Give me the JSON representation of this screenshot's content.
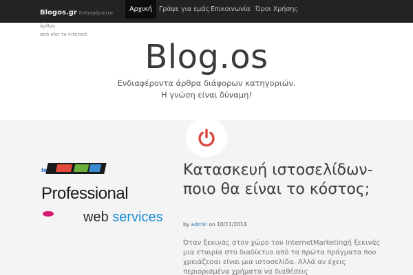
{
  "navbar": {
    "brand_name": "Blogos.gr",
    "brand_tag_1": "Ενδιαφέροντα άρθρα",
    "brand_tag_2": "από όλο το internet",
    "items": [
      {
        "label": "Αρχική",
        "active": true
      },
      {
        "label": "Γράψε για εμάς",
        "active": false
      },
      {
        "label": "Επικοινωνία",
        "active": false
      },
      {
        "label": "Όροι Χρήσης",
        "active": false
      }
    ]
  },
  "header": {
    "title": "Blog.os",
    "description_line_1": "Ενδιαφέροντα άρθρα διάφορων κατηγοριών.",
    "description_line_2": "Η γνώση είναι δύναμη!"
  },
  "icons": {
    "section_badge": "power-icon"
  },
  "colors": {
    "accent": "#d9463c",
    "navbar": "#232323",
    "content_bg": "#f4f4f4"
  },
  "post": {
    "image": {
      "corner_text": "le",
      "headline": "Professional",
      "line2_a": "web",
      "line2_b": "services"
    },
    "title": "Κατασκευή ιστοσελίδων- ποιο θα είναι το κόστος;",
    "meta_by": "by",
    "author": "admin",
    "meta_on": "on",
    "date": "10/11/2014",
    "excerpt": "Όταν ξεκινάς στον χώρο του InternetMarketingή ξεκινάς μια εταιρία στο διαδίκτυο από τα πρώτα πράγματα που χρειάζεσαι είναι μια ιστοσελίδα. Αλλά αν έχεις περιορισμένα χρήματα να διαθέσεις"
  }
}
